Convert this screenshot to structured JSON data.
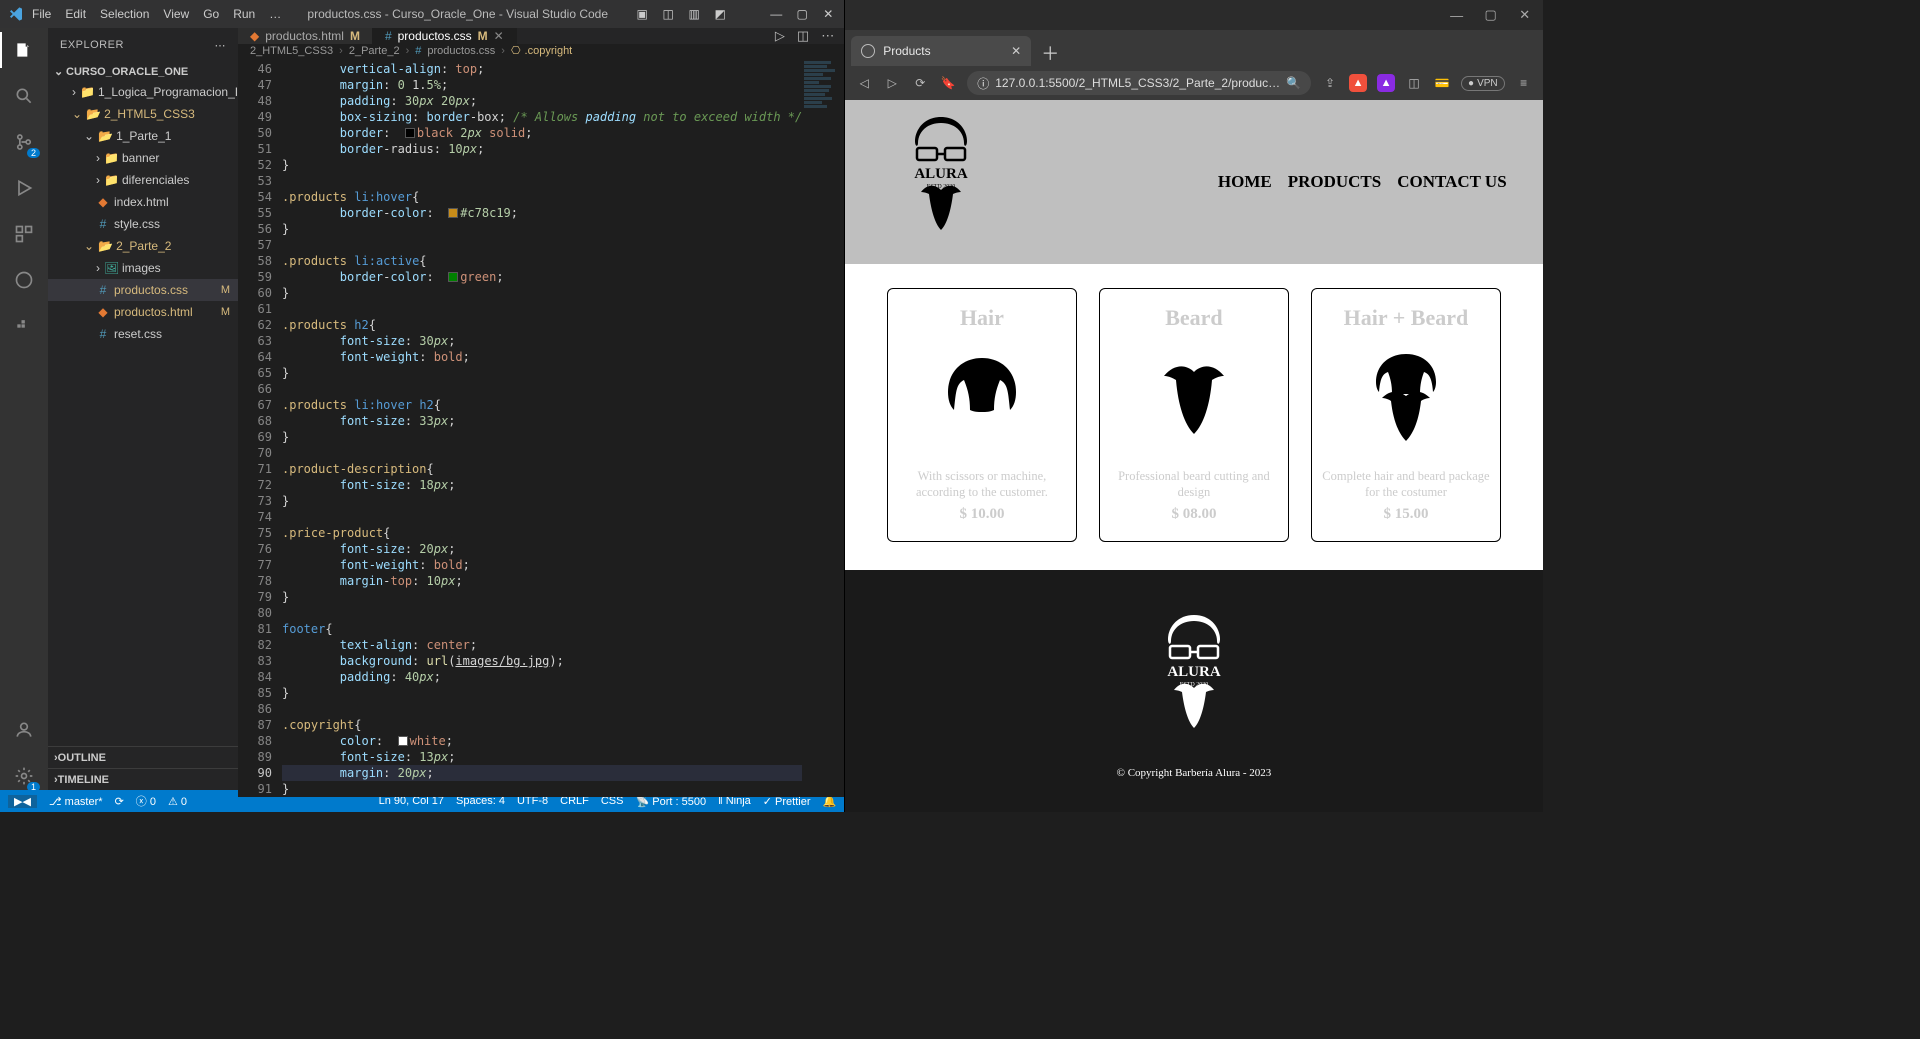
{
  "vscode": {
    "menu": [
      "File",
      "Edit",
      "Selection",
      "View",
      "Go",
      "Run",
      "…"
    ],
    "window_title": "productos.css - Curso_Oracle_One - Visual Studio Code",
    "explorer": {
      "header": "EXPLORER",
      "root": "CURSO_ORACLE_ONE",
      "tree": {
        "logica": "1_Logica_Programacion_I",
        "html5": "2_HTML5_CSS3",
        "parte1": "1_Parte_1",
        "banner": "banner",
        "diferenciales": "diferenciales",
        "index": "index.html",
        "style": "style.css",
        "parte2": "2_Parte_2",
        "images": "images",
        "prodcss": "productos.css",
        "prodhtml": "productos.html",
        "reset": "reset.css"
      },
      "outline": "OUTLINE",
      "timeline": "TIMELINE"
    },
    "tabs": [
      {
        "label": "productos.html",
        "mod": "M"
      },
      {
        "label": "productos.css",
        "mod": "M"
      }
    ],
    "breadcrumb": {
      "p1": "2_HTML5_CSS3",
      "p2": "2_Parte_2",
      "file": "productos.css",
      "sel": ".copyright"
    },
    "status": {
      "branch": "master*",
      "sync": "⟳",
      "errors": "0",
      "warnings": "0",
      "lncol": "Ln 90, Col 17",
      "spaces": "Spaces: 4",
      "enc": "UTF-8",
      "eol": "CRLF",
      "lang": "CSS",
      "port": "Port : 5500",
      "ninja": "Ninja",
      "prettier": "Prettier"
    },
    "code": {
      "l46": "        vertical-align: top;",
      "l47": "        margin: 0 1.5%;",
      "l48": "        padding: 30px 20px;",
      "l49": "        box-sizing: border-box; /* Allows padding not to exceed width */",
      "l50": "        border:  black 2px solid;",
      "l51": "        border-radius: 10px;",
      "l52": "}",
      "l53": "",
      "l54": ".products li:hover{",
      "l55": "        border-color:  #c78c19;",
      "l56": "}",
      "l57": "",
      "l58": ".products li:active{",
      "l59": "        border-color:  green;",
      "l60": "}",
      "l61": "",
      "l62": ".products h2{",
      "l63": "        font-size: 30px;",
      "l64": "        font-weight: bold;",
      "l65": "}",
      "l66": "",
      "l67": ".products li:hover h2{",
      "l68": "        font-size: 33px;",
      "l69": "}",
      "l70": "",
      "l71": ".product-description{",
      "l72": "        font-size: 18px;",
      "l73": "}",
      "l74": "",
      "l75": ".price-product{",
      "l76": "        font-size: 20px;",
      "l77": "        font-weight: bold;",
      "l78": "        margin-top: 10px;",
      "l79": "}",
      "l80": "",
      "l81": "footer{",
      "l82": "        text-align: center;",
      "l83": "        background: url(images/bg.jpg);",
      "l84": "        padding: 40px;",
      "l85": "}",
      "l86": "",
      "l87": ".copyright{",
      "l88": "        color:  white;",
      "l89": "        font-size: 13px;",
      "l90": "        margin: 20px;",
      "l91": "}"
    }
  },
  "browser": {
    "tab_title": "Products",
    "url": "127.0.0.1:5500/2_HTML5_CSS3/2_Parte_2/produc…",
    "vpn": "VPN",
    "page": {
      "nav": {
        "home": "HOME",
        "products": "PRODUCTS",
        "contact": "CONTACT US"
      },
      "logo_top": "ALURA",
      "logo_sub": "ESTD        2020",
      "cards": [
        {
          "title": "Hair",
          "desc": "With scissors or machine, according to the customer.",
          "price": "$ 10.00"
        },
        {
          "title": "Beard",
          "desc": "Professional beard cutting and design",
          "price": "$ 08.00"
        },
        {
          "title": "Hair + Beard",
          "desc": "Complete hair and beard package for the costumer",
          "price": "$ 15.00"
        }
      ],
      "copyright": "© Copyright Barbería Alura - 2023"
    }
  }
}
